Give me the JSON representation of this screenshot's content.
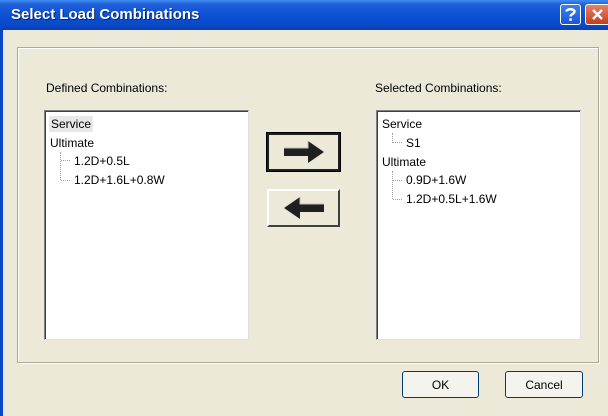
{
  "window": {
    "title": "Select Load Combinations"
  },
  "titlebar": {
    "help_icon": "help-icon",
    "close_icon": "close-icon"
  },
  "left": {
    "label": "Defined Combinations:",
    "items": [
      {
        "label": "Service",
        "level": 0,
        "selected": true
      },
      {
        "label": "Ultimate",
        "level": 0,
        "selected": false
      },
      {
        "label": "1.2D+0.5L",
        "level": 1,
        "selected": false
      },
      {
        "label": "1.2D+1.6L+0.8W",
        "level": 1,
        "selected": false
      }
    ]
  },
  "right": {
    "label": "Selected Combinations:",
    "items": [
      {
        "label": "Service",
        "level": 0
      },
      {
        "label": "S1",
        "level": 1
      },
      {
        "label": "Ultimate",
        "level": 0
      },
      {
        "label": "0.9D+1.6W",
        "level": 1
      },
      {
        "label": "1.2D+0.5L+1.6W",
        "level": 1
      }
    ]
  },
  "buttons": {
    "add_icon": "arrow-right-icon",
    "remove_icon": "arrow-left-icon",
    "ok": "OK",
    "cancel": "Cancel"
  }
}
